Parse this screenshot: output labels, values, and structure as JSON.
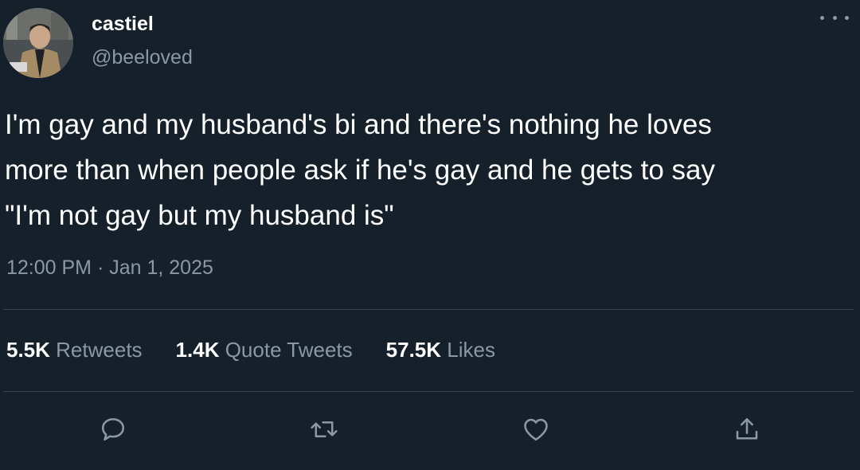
{
  "author": {
    "display_name": "castiel",
    "handle": "@beeloved",
    "avatar": "profile-photo"
  },
  "tweet": {
    "text": "I'm gay and my husband's bi and there's nothing he loves\nmore than when people ask if he's gay and he gets to say\n\"I'm not gay but my husband is\"",
    "timestamp": "12:00 PM · Jan 1, 2025"
  },
  "stats": {
    "retweets_count": "5.5K",
    "retweets_label": "Retweets",
    "quotes_count": "1.4K",
    "quotes_label": "Quote Tweets",
    "likes_count": "57.5K",
    "likes_label": "Likes"
  },
  "actions": [
    "reply-icon",
    "retweet-icon",
    "like-icon",
    "share-icon"
  ],
  "colors": {
    "background": "#15202b",
    "text_primary": "#ffffff",
    "text_secondary": "#8b98a5",
    "divider": "#38444d"
  }
}
